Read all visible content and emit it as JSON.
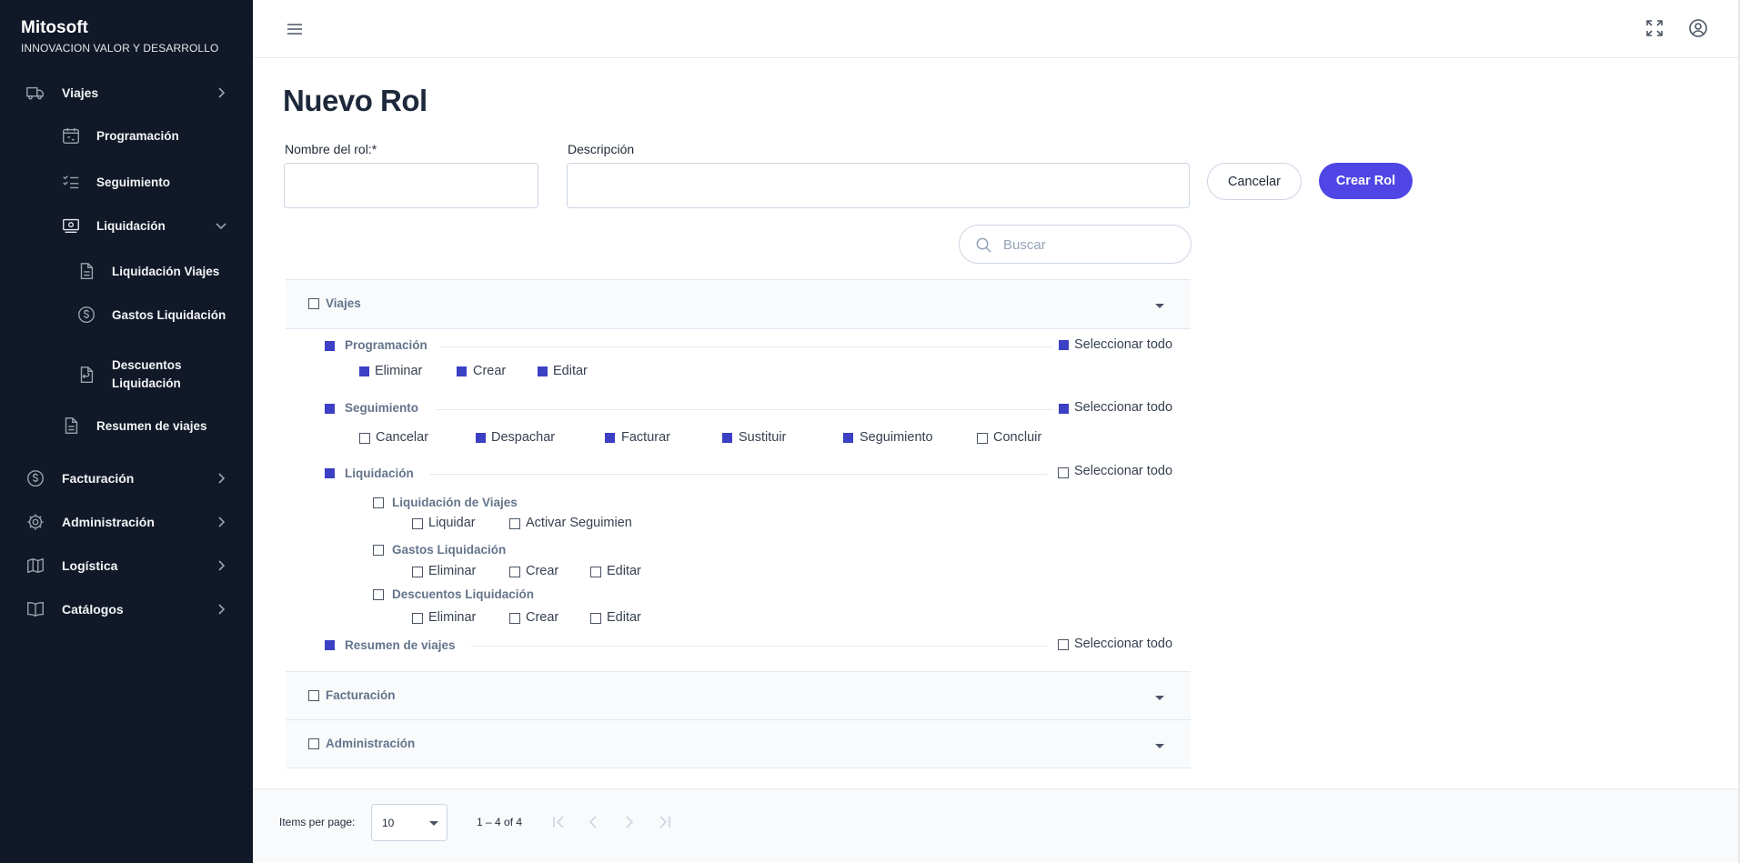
{
  "brand": {
    "name": "Mitosoft",
    "tagline": "INNOVACION VALOR Y DESARROLLO"
  },
  "sidebar": {
    "items": [
      {
        "label": "Viajes",
        "icon": "truck-icon"
      },
      {
        "label": "Programación",
        "icon": "calendar-icon"
      },
      {
        "label": "Seguimiento",
        "icon": "checklist-icon"
      },
      {
        "label": "Liquidación",
        "icon": "cash-icon"
      },
      {
        "label": "Liquidación Viajes",
        "icon": "document-icon"
      },
      {
        "label": "Gastos Liquidación",
        "icon": "dollar-circle-icon"
      },
      {
        "label": "Descuentos",
        "label2": "Liquidación",
        "icon": "document-refund-icon"
      },
      {
        "label": "Resumen de viajes",
        "icon": "document-icon"
      },
      {
        "label": "Facturación",
        "icon": "dollar-circle-icon"
      },
      {
        "label": "Administración",
        "icon": "gear-icon"
      },
      {
        "label": "Logística",
        "icon": "map-icon"
      },
      {
        "label": "Catálogos",
        "icon": "book-icon"
      }
    ]
  },
  "page": {
    "title": "Nuevo Rol",
    "name_label": "Nombre del rol:*",
    "desc_label": "Descripción",
    "name_value": "",
    "desc_value": "",
    "cancel": "Cancelar",
    "create": "Crear Rol",
    "search_placeholder": "Buscar"
  },
  "panels": {
    "viajes": "Viajes",
    "facturacion": "Facturación",
    "administracion": "Administración"
  },
  "permissions": {
    "select_all": "Seleccionar todo",
    "programacion": {
      "title": "Programación",
      "actions": [
        "Eliminar",
        "Crear",
        "Editar"
      ]
    },
    "seguimiento": {
      "title": "Seguimiento",
      "actions": [
        "Cancelar",
        "Despachar",
        "Facturar",
        "Sustituir",
        "Seguimiento",
        "Concluir"
      ]
    },
    "liquidacion": {
      "title": "Liquidación",
      "liq_viajes": {
        "title": "Liquidación de Viajes",
        "actions": [
          "Liquidar",
          "Activar Seguimien"
        ]
      },
      "gastos": {
        "title": "Gastos Liquidación",
        "actions": [
          "Eliminar",
          "Crear",
          "Editar"
        ]
      },
      "descuentos": {
        "title": "Descuentos Liquidación",
        "actions": [
          "Eliminar",
          "Crear",
          "Editar"
        ]
      }
    },
    "resumen": {
      "title": "Resumen de viajes"
    }
  },
  "footer": {
    "items_per_page_label": "Items per page:",
    "items_per_page": "10",
    "range": "1 – 4 of 4"
  },
  "colors": {
    "sidebar": "#111827",
    "accent": "#4f46e5",
    "checked": "#3b40c4"
  }
}
